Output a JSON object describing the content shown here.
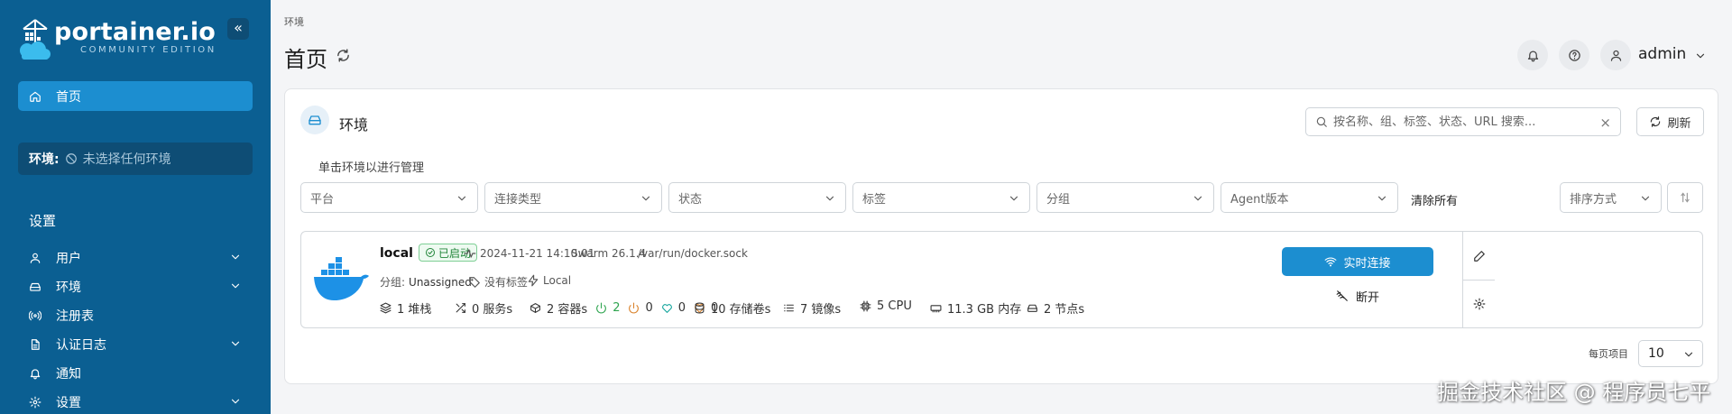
{
  "sidebar": {
    "logo_name": "portainer.io",
    "logo_sub": "COMMUNITY EDITION",
    "collapse_symbol": "«",
    "home_label": "首页",
    "env_label": "环境:",
    "env_value": "未选择任何环境",
    "settings_heading": "设置",
    "items": [
      {
        "label": "用户",
        "icon": "user-icon",
        "expandable": true
      },
      {
        "label": "环境",
        "icon": "drive-icon",
        "expandable": true
      },
      {
        "label": "注册表",
        "icon": "radio-icon",
        "expandable": false
      },
      {
        "label": "认证日志",
        "icon": "file-icon",
        "expandable": true
      },
      {
        "label": "通知",
        "icon": "bell-icon",
        "expandable": false
      },
      {
        "label": "设置",
        "icon": "gear-icon",
        "expandable": true
      }
    ]
  },
  "header": {
    "breadcrumb": "环境",
    "title": "首页",
    "user": "admin"
  },
  "panel": {
    "title": "环境",
    "search_placeholder": "按名称、组、标签、状态、URL 搜索...",
    "search_clear": "×",
    "refresh_label": "刷新",
    "hint": "单击环境以进行管理",
    "filters": [
      "平台",
      "连接类型",
      "状态",
      "标签",
      "分组",
      "Agent版本"
    ],
    "clear_all": "清除所有",
    "sort_label": "排序方式"
  },
  "environment": {
    "name": "local",
    "status": "已启动",
    "timestamp": "2024-11-21 14:10:01",
    "swarm": "Swarm 26.1.4",
    "socket": "/var/run/docker.sock",
    "group_label": "分组:",
    "group_value": "Unassigned",
    "tags": "没有标签",
    "type": "Local",
    "stacks": "1 堆栈",
    "services": "0 服务s",
    "containers": "2 容器s",
    "healthy_running": "2",
    "stopped": "0",
    "healthy": "0",
    "unhealthy": "0",
    "volumes": "10 存储卷s",
    "images": "7 镜像s",
    "cpu": "5 CPU",
    "memory": "11.3 GB 内存",
    "nodes": "2 节点s",
    "live_connect": "实时连接",
    "disconnect": "断开"
  },
  "pagination": {
    "per_page_label": "每页项目",
    "per_page_value": "10"
  },
  "watermark": "掘金技术社区 @ 程序员七平",
  "colors": {
    "sidebar_bg": "#0b5f92",
    "accent": "#1c8ed0",
    "status_green": "#22863a"
  }
}
